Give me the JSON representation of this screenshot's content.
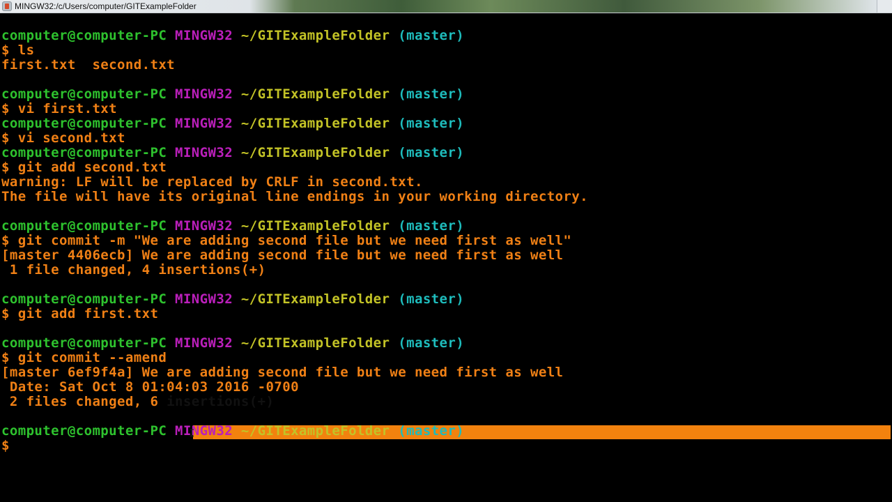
{
  "window": {
    "title": "MINGW32:/c/Users/computer/GITExampleFolder",
    "icon": "git-bash-icon"
  },
  "colors": {
    "user": "#2ec22e",
    "host": "#bb1fbb",
    "path": "#c3c326",
    "branch": "#1ebcbc",
    "output": "#f08015",
    "highlight": "#f2820e"
  },
  "prompt": {
    "user_host": "computer@computer-PC",
    "system": "MINGW32",
    "path": "~/GITExampleFolder",
    "branch": "(master)",
    "symbol": "$"
  },
  "lines": [
    {
      "type": "prompt"
    },
    {
      "type": "command",
      "text": "$ ls"
    },
    {
      "type": "output",
      "text": "first.txt  second.txt"
    },
    {
      "type": "blank"
    },
    {
      "type": "prompt"
    },
    {
      "type": "command",
      "text": "$ vi first.txt"
    },
    {
      "type": "prompt"
    },
    {
      "type": "command",
      "text": "$ vi second.txt"
    },
    {
      "type": "prompt"
    },
    {
      "type": "command",
      "text": "$ git add second.txt"
    },
    {
      "type": "output",
      "text": "warning: LF will be replaced by CRLF in second.txt."
    },
    {
      "type": "output",
      "text": "The file will have its original line endings in your working directory."
    },
    {
      "type": "blank"
    },
    {
      "type": "prompt"
    },
    {
      "type": "command",
      "text": "$ git commit -m \"We are adding second file but we need first as well\""
    },
    {
      "type": "output",
      "text": "[master 4406ecb] We are adding second file but we need first as well"
    },
    {
      "type": "output",
      "text": " 1 file changed, 4 insertions(+)"
    },
    {
      "type": "blank"
    },
    {
      "type": "prompt"
    },
    {
      "type": "command",
      "text": "$ git add first.txt"
    },
    {
      "type": "blank"
    },
    {
      "type": "prompt"
    },
    {
      "type": "command",
      "text": "$ git commit --amend"
    },
    {
      "type": "output",
      "text": "[master 6ef9f4a] We are adding second file but we need first as well"
    },
    {
      "type": "output",
      "text": " Date: Sat Oct 8 01:04:03 2016 -0700"
    },
    {
      "type": "output-highlight",
      "text": " 2 files changed, 6",
      "highlighted": " insertions(+)"
    },
    {
      "type": "blank"
    },
    {
      "type": "prompt"
    },
    {
      "type": "command",
      "text": "$"
    }
  ]
}
